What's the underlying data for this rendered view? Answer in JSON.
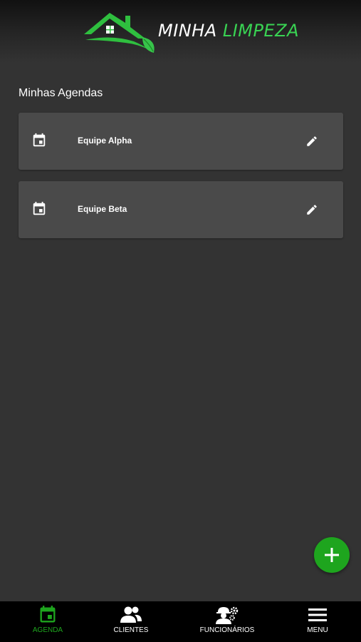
{
  "header": {
    "logo_word1": "MINHA",
    "logo_word2": "LIMPEZA",
    "logo_icon": "house-roof-leaf-icon"
  },
  "main": {
    "section_title": "Minhas Agendas",
    "agendas": [
      {
        "name": "Equipe Alpha",
        "icon": "calendar-icon",
        "action_icon": "edit-pencil-icon"
      },
      {
        "name": "Equipe Beta",
        "icon": "calendar-icon",
        "action_icon": "edit-pencil-icon"
      }
    ]
  },
  "fab": {
    "icon": "plus-icon"
  },
  "bottom_nav": {
    "active": "AGENDA",
    "items": [
      {
        "label": "AGENDA",
        "icon": "calendar-icon"
      },
      {
        "label": "CLIENTES",
        "icon": "people-icon"
      },
      {
        "label": "FUNCIONÁRIOS",
        "icon": "worker-gear-icon"
      },
      {
        "label": "MENU",
        "icon": "hamburger-menu-icon"
      }
    ]
  },
  "colors": {
    "background": "#333333",
    "card": "#4a4a4a",
    "accent_green": "#1ea51e",
    "logo_green": "#39d353",
    "nav_background": "#000000"
  }
}
